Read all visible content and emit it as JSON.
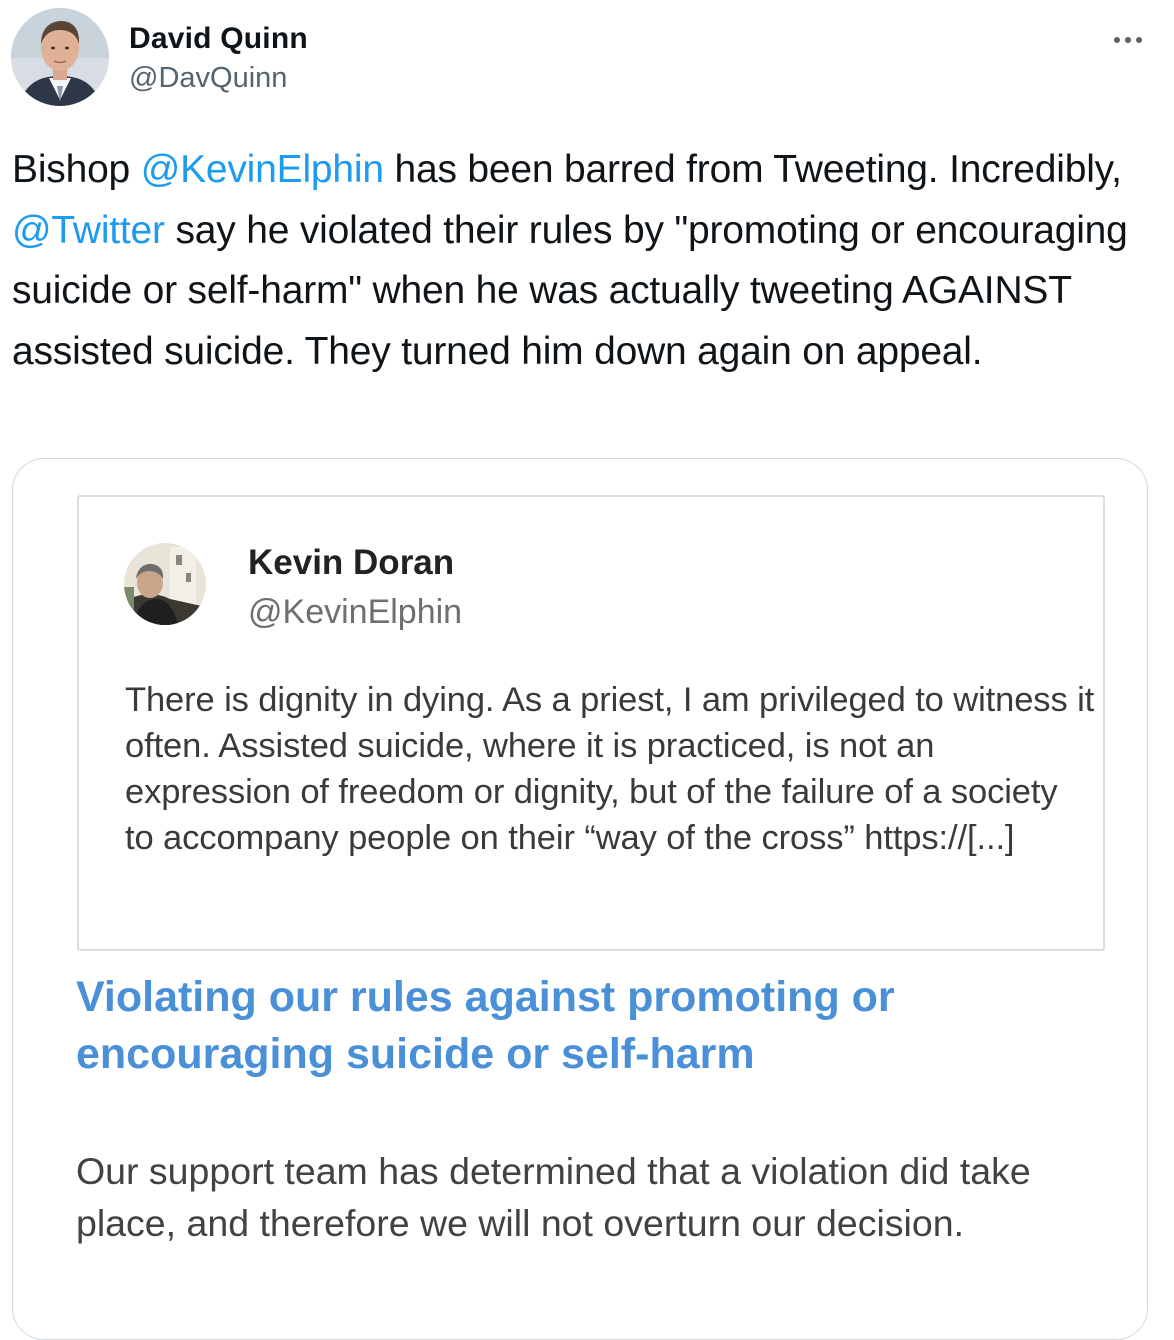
{
  "author": {
    "name": "David Quinn",
    "handle": "@DavQuinn"
  },
  "more_icon": "more-horizontal-icon",
  "tweet": {
    "text_1": "Bishop ",
    "mention_1": "@KevinElphin",
    "text_2": " has been barred from Tweeting. Incredibly, ",
    "mention_2": "@Twitter",
    "text_3": " say he violated their rules by \"promoting or encouraging suicide or self-harm\" when he was actually tweeting AGAINST assisted suicide. They turned him down again on appeal."
  },
  "screenshot": {
    "inner_tweet": {
      "name": "Kevin Doran",
      "handle": "@KevinElphin",
      "text": "There is dignity in dying. As a priest, I am privileged to witness it often. Assisted suicide, where it is practiced, is not an expression of freedom or dignity, but of the failure of a society to accompany people on their “way of the cross” https://[...]"
    },
    "violation_heading": "Violating our rules against promoting or encouraging suicide or self-harm",
    "support_text": "Our support team has determined that a violation did take place, and therefore we will not overturn our decision."
  },
  "colors": {
    "link": "#1d9bf0",
    "heading_blue": "#4a90d8",
    "secondary_text": "#536471"
  }
}
